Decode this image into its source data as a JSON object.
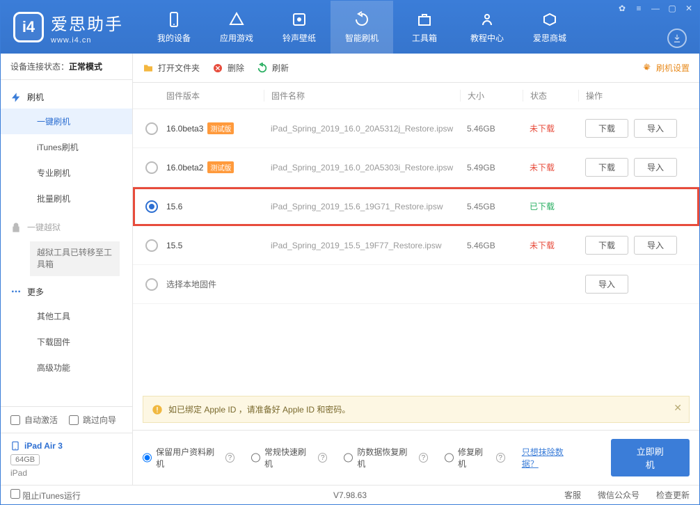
{
  "header": {
    "app_name": "爱思助手",
    "site": "www.i4.cn",
    "nav": [
      "我的设备",
      "应用游戏",
      "铃声壁纸",
      "智能刷机",
      "工具箱",
      "教程中心",
      "爱思商城"
    ],
    "active_nav": 3
  },
  "sidebar": {
    "conn_label": "设备连接状态：",
    "conn_value": "正常模式",
    "group_flash": "刷机",
    "items_flash": [
      "一键刷机",
      "iTunes刷机",
      "专业刷机",
      "批量刷机"
    ],
    "active_flash": 0,
    "group_jb": "一键越狱",
    "jb_note": "越狱工具已转移至工具箱",
    "group_more": "更多",
    "items_more": [
      "其他工具",
      "下载固件",
      "高级功能"
    ],
    "auto_activate": "自动激活",
    "skip_guide": "跳过向导",
    "device_name": "iPad Air 3",
    "device_cap": "64GB",
    "device_type": "iPad"
  },
  "toolbar": {
    "open": "打开文件夹",
    "delete": "删除",
    "refresh": "刷新",
    "settings": "刷机设置"
  },
  "columns": {
    "version": "固件版本",
    "name": "固件名称",
    "size": "大小",
    "status": "状态",
    "op": "操作"
  },
  "buttons": {
    "download": "下载",
    "import": "导入"
  },
  "status": {
    "not_downloaded": "未下载",
    "downloaded": "已下载"
  },
  "beta_tag": "测试版",
  "rows": [
    {
      "version": "16.0beta3",
      "beta": true,
      "name": "iPad_Spring_2019_16.0_20A5312j_Restore.ipsw",
      "size": "5.46GB",
      "status": "not_downloaded",
      "selected": false,
      "ops": [
        "download",
        "import"
      ],
      "highlight": false
    },
    {
      "version": "16.0beta2",
      "beta": true,
      "name": "iPad_Spring_2019_16.0_20A5303i_Restore.ipsw",
      "size": "5.49GB",
      "status": "not_downloaded",
      "selected": false,
      "ops": [
        "download",
        "import"
      ],
      "highlight": false
    },
    {
      "version": "15.6",
      "beta": false,
      "name": "iPad_Spring_2019_15.6_19G71_Restore.ipsw",
      "size": "5.45GB",
      "status": "downloaded",
      "selected": true,
      "ops": [],
      "highlight": true
    },
    {
      "version": "15.5",
      "beta": false,
      "name": "iPad_Spring_2019_15.5_19F77_Restore.ipsw",
      "size": "5.46GB",
      "status": "not_downloaded",
      "selected": false,
      "ops": [
        "download",
        "import"
      ],
      "highlight": false
    }
  ],
  "local_row": {
    "label": "选择本地固件",
    "op": "import"
  },
  "notice": "如已绑定 Apple ID ，请准备好 Apple ID 和密码。",
  "flash_options": {
    "items": [
      "保留用户资料刷机",
      "常规快速刷机",
      "防数据恢复刷机",
      "修复刷机"
    ],
    "selected": 0,
    "only_erase": "只想抹除数据？",
    "go": "立即刷机"
  },
  "footer": {
    "block_itunes": "阻止iTunes运行",
    "version": "V7.98.63",
    "links": [
      "客服",
      "微信公众号",
      "检查更新"
    ]
  }
}
